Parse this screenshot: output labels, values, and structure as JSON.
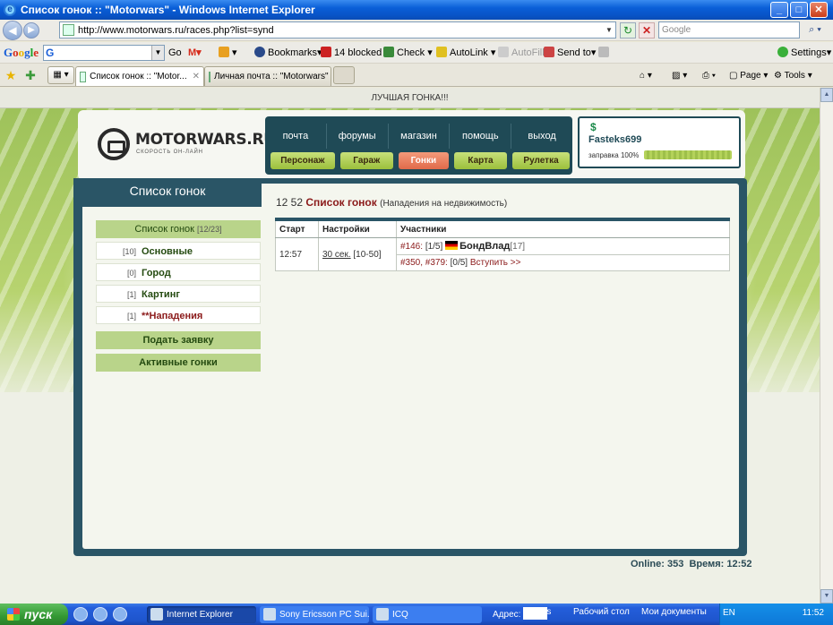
{
  "window": {
    "title": "Список гонок :: \"Motorwars\" - Windows Internet Explorer",
    "minimize": "_",
    "maximize": "□",
    "close": "✕"
  },
  "address_bar": {
    "url": "http://www.motorwars.ru/races.php?list=synd",
    "search_placeholder": "Google"
  },
  "google_toolbar": {
    "logo": [
      "G",
      "o",
      "o",
      "g",
      "l",
      "e"
    ],
    "go_label": "Go",
    "bookmarks_label": "Bookmarks",
    "blocked_label": "14 blocked",
    "check_label": "Check",
    "autolink_label": "AutoLink",
    "autofill_label": "AutoFill",
    "sendto_label": "Send to",
    "settings_label": "Settings"
  },
  "tabs": [
    {
      "label": "Список гонок :: \"Motor...",
      "active": true
    },
    {
      "label": "Личная почта :: \"Motorwars\"",
      "active": false
    }
  ],
  "command_bar": {
    "page_label": "Page",
    "tools_label": "Tools"
  },
  "page": {
    "banner": "ЛУЧШАЯ ГОНКА!!!",
    "logo_name": "MOTORWARS.RU",
    "logo_tagline": "СКОРОСТЬ ОН-ЛАЙН",
    "top_nav": [
      "почта",
      "форумы",
      "магазин",
      "помощь",
      "выход"
    ],
    "sub_nav": [
      {
        "label": "Персонаж",
        "active": false
      },
      {
        "label": "Гараж",
        "active": false
      },
      {
        "label": "Гонки",
        "active": true
      },
      {
        "label": "Карта",
        "active": false
      },
      {
        "label": "Рулетка",
        "active": false
      }
    ],
    "user": {
      "currency_symbol": "$",
      "name": "Fasteks699",
      "fuel_label": "заправка 100%",
      "fuel_level": 1.0
    },
    "left_panel": {
      "title": "Список гонок",
      "header": {
        "label": "Список гонок",
        "count": "[12/23]"
      },
      "items": [
        {
          "idx": "[10]",
          "label": "Основные"
        },
        {
          "idx": "[0]",
          "label": "Город"
        },
        {
          "idx": "[1]",
          "label": "Картинг"
        },
        {
          "idx": "[1]",
          "label": "**Нападения"
        }
      ],
      "apply_button": "Подать заявку",
      "active_races_button": "Активные гонки"
    },
    "races": {
      "time": "12 52",
      "title": "Список гонок",
      "subtitle": "(Нападения на недвижимость)",
      "columns": [
        "Старт",
        "Настройки",
        "Участники"
      ],
      "rows": [
        {
          "start": "12:57",
          "settings_link": "30 сек.",
          "settings_range": "[10-50]",
          "line1_ref": "#146:",
          "line1_count": "[1/5]",
          "line1_player": "БондВлад",
          "line1_level": "[17]",
          "line2_refs": "#350, #379:",
          "line2_count": "[0/5]",
          "line2_join": "Вступить >>"
        }
      ]
    },
    "footer": {
      "online_label": "Online:",
      "online_value": "353",
      "time_label": "Время:",
      "time_value": "12:52"
    }
  },
  "taskbar": {
    "start_label": "пуск",
    "buttons": [
      {
        "label": "Internet Explorer",
        "active": true
      },
      {
        "label": "Sony Ericsson PC Sui...",
        "active": false
      },
      {
        "label": "ICQ",
        "active": false
      }
    ],
    "address_label": "Адрес:",
    "links_label": "Links",
    "desktop_label": "Рабочий стол",
    "mydocs_label": "Мои документы",
    "lang": "EN",
    "clock": "11:52"
  },
  "colors": {
    "frame": "#2a5566",
    "menu_green": "#b9d48a",
    "accent_red": "#8b1a1a",
    "active_subnav": "#e06a4a"
  }
}
